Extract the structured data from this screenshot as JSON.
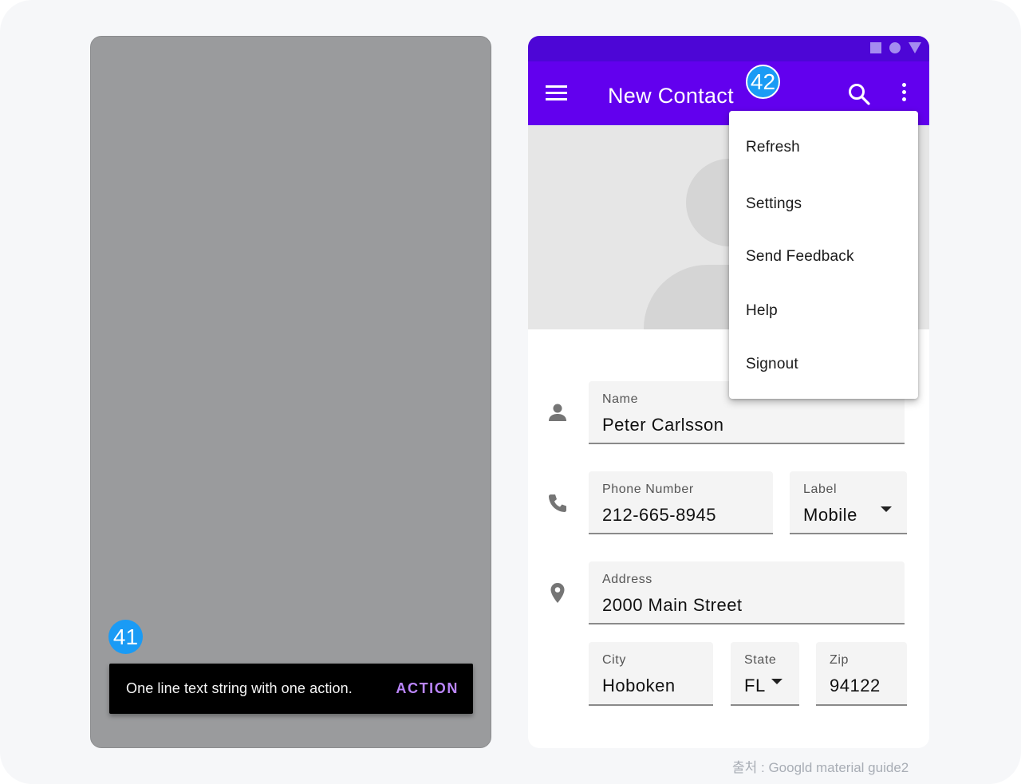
{
  "snackbar_example": {
    "badge": "41",
    "message": "One line text string with one action.",
    "action_label": "ACTION"
  },
  "contact_app": {
    "badge": "42",
    "app_bar": {
      "title": "New Contact",
      "nav_icon": "menu-icon",
      "actions": [
        "search-icon",
        "more-vert-icon"
      ]
    },
    "status_icons": [
      "square-icon",
      "circle-icon",
      "triangle-icon"
    ],
    "overflow_menu": [
      "Refresh",
      "Settings",
      "Send Feedback",
      "Help",
      "Signout"
    ],
    "form": {
      "name": {
        "label": "Name",
        "value": "Peter Carlsson",
        "icon": "person-icon"
      },
      "phone": {
        "label": "Phone Number",
        "value": "212-665-8945",
        "icon": "phone-icon"
      },
      "phone_label": {
        "label": "Label",
        "value": "Mobile"
      },
      "address": {
        "label": "Address",
        "value": "2000 Main Street",
        "icon": "location-pin-icon"
      },
      "city": {
        "label": "City",
        "value": "Hoboken"
      },
      "state": {
        "label": "State",
        "value": "FL"
      },
      "zip": {
        "label": "Zip",
        "value": "94122"
      }
    }
  },
  "colors": {
    "primary": "#6200ee",
    "primary_dark": "#4d06d6",
    "snackbar_action": "#bb86fc",
    "badge": "#1a9bf5",
    "scrim": "#9a9b9d"
  },
  "source_caption": "출처 : Googld material guide2"
}
